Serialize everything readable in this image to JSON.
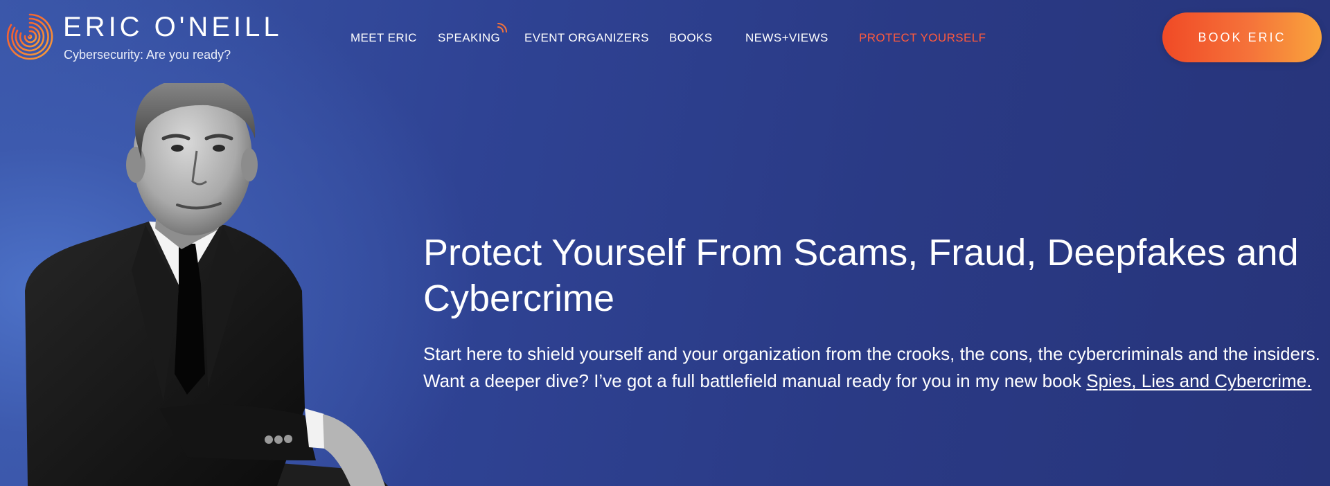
{
  "brand": {
    "name": "ERIC O'NEILL",
    "tagline": "Cybersecurity: Are you ready?",
    "accent_color": "#f5733a"
  },
  "nav": {
    "items": [
      {
        "label": "MEET ERIC"
      },
      {
        "label": "SPEAKING"
      },
      {
        "label": "EVENT ORGANIZERS"
      },
      {
        "label": "BOOKS"
      },
      {
        "label": "NEWS+VIEWS"
      },
      {
        "label": "PROTECT YOURSELF",
        "active": true
      }
    ],
    "active_color": "#ff5a3c",
    "cta_label": "BOOK ERIC"
  },
  "hero": {
    "title": "Protect Yourself From Scams, Fraud, Deepfakes and Cybercrime",
    "body": "Start here to shield yourself and your organization from the crooks, the cons, the cybercriminals and the insiders. Want a deeper dive? I’ve got a full battlefield manual ready for you in my new book ",
    "book_link": "Spies, Lies and Cybercrime."
  }
}
